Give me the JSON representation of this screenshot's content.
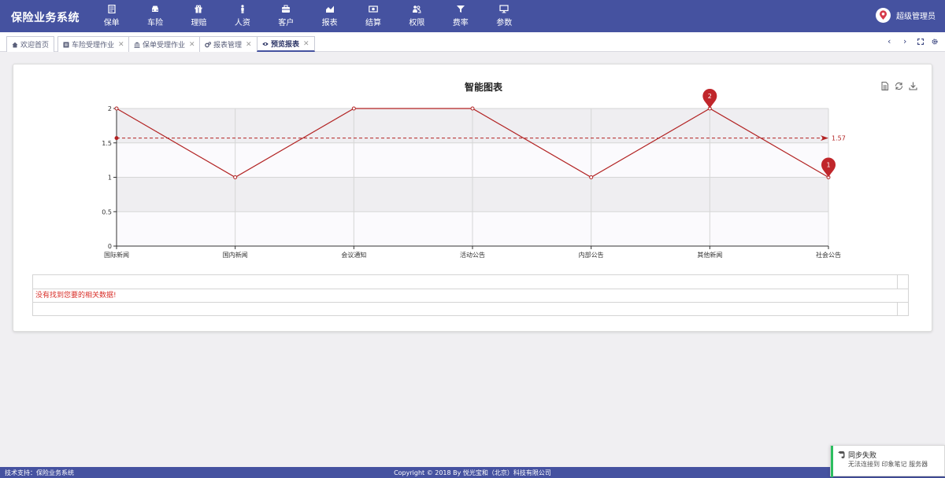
{
  "app": {
    "title": "保险业务系统"
  },
  "nav": [
    {
      "label": "保单",
      "icon": "document-icon"
    },
    {
      "label": "车险",
      "icon": "car-icon"
    },
    {
      "label": "理赔",
      "icon": "gift-icon"
    },
    {
      "label": "人资",
      "icon": "person-icon"
    },
    {
      "label": "客户",
      "icon": "briefcase-icon"
    },
    {
      "label": "报表",
      "icon": "area-chart-icon"
    },
    {
      "label": "结算",
      "icon": "money-icon"
    },
    {
      "label": "权限",
      "icon": "users-icon"
    },
    {
      "label": "费率",
      "icon": "filter-icon"
    },
    {
      "label": "参数",
      "icon": "monitor-icon"
    }
  ],
  "user": {
    "name": "超级管理员"
  },
  "tabs": [
    {
      "label": "欢迎首页",
      "icon": "home-icon",
      "closable": false,
      "active": false
    },
    {
      "label": "车险受理作业",
      "icon": "list-icon",
      "closable": true,
      "active": false
    },
    {
      "label": "保单受理作业",
      "icon": "bank-icon",
      "closable": true,
      "active": false
    },
    {
      "label": "报表管理",
      "icon": "gears-icon",
      "closable": true,
      "active": false
    },
    {
      "label": "预览报表",
      "icon": "eye-icon",
      "closable": true,
      "active": true
    }
  ],
  "tab_controls": [
    "prev-icon",
    "next-icon",
    "fullscreen-icon",
    "settings-icon"
  ],
  "chart_tools": [
    "data-view-icon",
    "restore-icon",
    "save-image-icon"
  ],
  "chart_data": {
    "type": "line",
    "title": "智能图表",
    "categories": [
      "国际新闻",
      "国内新闻",
      "会议通知",
      "活动公告",
      "内部公告",
      "其他新闻",
      "社会公告"
    ],
    "series": [
      {
        "values": [
          2,
          1,
          2,
          2,
          1,
          2,
          1
        ],
        "color": "#b22222"
      }
    ],
    "y_ticks": [
      "0",
      "0.5",
      "1",
      "1.5",
      "2"
    ],
    "ylim": [
      0,
      2
    ],
    "mark_line": {
      "type": "average",
      "value": 1.57,
      "label": "1.57"
    },
    "mark_points": [
      {
        "label": "2",
        "category": "其他新闻",
        "value": 2
      },
      {
        "label": "1",
        "category": "社会公告",
        "value": 1
      }
    ],
    "split_area": true,
    "grid": true
  },
  "table": {
    "empty_message": "没有找到您要的相关数据!"
  },
  "footer": {
    "left": "技术支持：保险业务系统",
    "center": "Copyright © 2018 By 悦光宝和（北京）科技有限公司"
  },
  "toast": {
    "title": "同步失败",
    "message": "无法连接到 印象笔记 服务器"
  },
  "colors": {
    "primary": "#4552a0",
    "series": "#b22222",
    "error": "#d9302a",
    "toast_accent": "#2dbe60"
  }
}
